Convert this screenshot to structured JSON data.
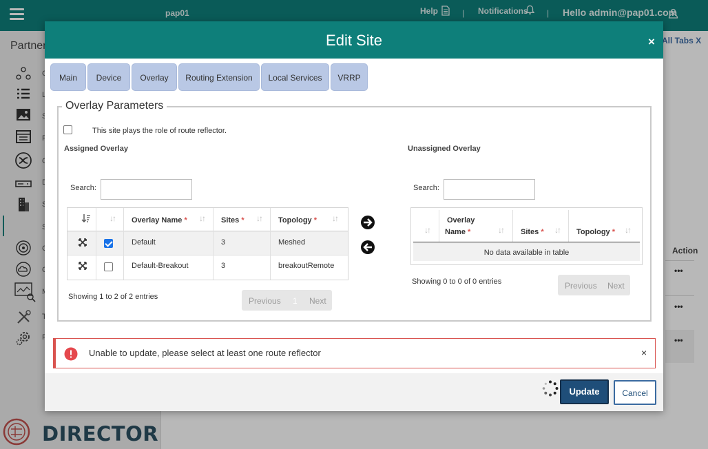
{
  "topbar": {
    "org": "pap01",
    "help": "Help",
    "notifications": "Notifications",
    "separator": "|",
    "hello": "Hello admin@pap01.com"
  },
  "sidebar": {
    "partner": "Partner",
    "brand": "DIRECTOR",
    "letters": [
      "C",
      "L",
      "S",
      "R",
      "C",
      "D",
      "S",
      "S",
      "C",
      "C",
      "M",
      "T",
      "P"
    ]
  },
  "background": {
    "all_tabs": "All Tabs X",
    "action_header": "Action",
    "row_menu": "•••"
  },
  "modal": {
    "title": "Edit Site",
    "close": "×",
    "tabs": [
      "Main",
      "Device",
      "Overlay",
      "Routing Extension",
      "Local Services",
      "VRRP"
    ],
    "section_title": "Overlay Parameters",
    "route_reflector": {
      "label": "This site plays the role of route reflector.",
      "checked": false
    },
    "assigned": {
      "title": "Assigned Overlay",
      "search_label": "Search:",
      "search_value": "",
      "columns": [
        "Overlay Name",
        "Sites",
        "Topology"
      ],
      "required_mark": "*",
      "rows": [
        {
          "selected": true,
          "name": "Default",
          "sites": "3",
          "topology": "Meshed"
        },
        {
          "selected": false,
          "name": "Default-Breakout",
          "sites": "3",
          "topology": "breakoutRemote"
        }
      ],
      "info": "Showing 1 to 2 of 2 entries",
      "previous": "Previous",
      "page": "1",
      "next": "Next"
    },
    "unassigned": {
      "title": "Unassigned Overlay",
      "search_label": "Search:",
      "search_value": "",
      "col_overlay_line1": "Overlay",
      "col_overlay_line2": "Name",
      "col_sites": "Sites",
      "col_topology": "Topology",
      "required_mark": "*",
      "empty": "No data available in table",
      "info": "Showing 0 to 0 of 0 entries",
      "previous": "Previous",
      "next": "Next"
    },
    "alert": {
      "message": "Unable to update, please select at least one route reflector",
      "close": "×",
      "color": "#d9534f"
    },
    "footer": {
      "update": "Update",
      "cancel": "Cancel"
    }
  },
  "colors": {
    "brand_teal": "#0e7f7a",
    "tab_bg": "#b9c8e5",
    "primary_button": "#1f4e79",
    "checkbox_checked": "#1a73e8"
  },
  "icons": [
    "hamburger-icon",
    "help-document-icon",
    "bell-icon",
    "user-icon",
    "expand-icon",
    "arrow-right-icon",
    "arrow-left-icon",
    "error-icon",
    "sort-icon",
    "loading-spinner-icon",
    "director-logo-icon"
  ]
}
